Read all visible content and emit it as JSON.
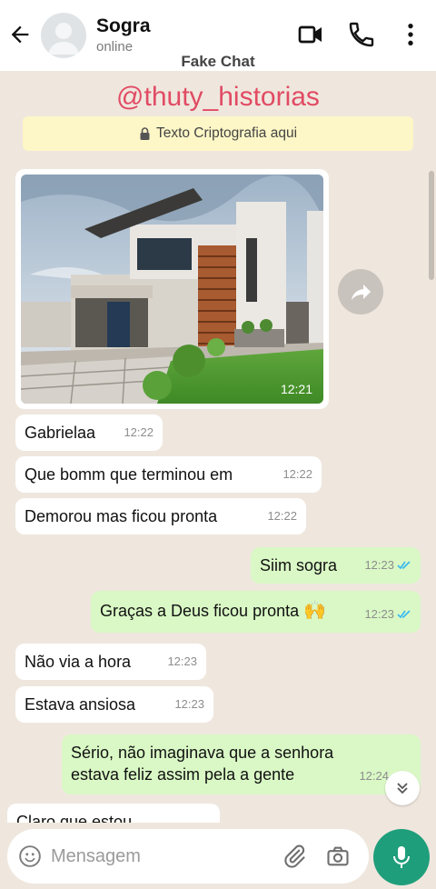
{
  "header": {
    "contact_name": "Sogra",
    "status": "online",
    "app_watermark": "Fake Chat"
  },
  "chat": {
    "user_watermark": "@thuty_historias",
    "encryption_notice": "Texto Criptografia aqui",
    "image_message": {
      "time": "12:21"
    },
    "messages": [
      {
        "dir": "in",
        "text": "Gabrielaa",
        "time": "12:22"
      },
      {
        "dir": "in",
        "text": "Que bomm que terminou em",
        "time": "12:22"
      },
      {
        "dir": "in",
        "text": "Demorou mas ficou pronta",
        "time": "12:22"
      },
      {
        "dir": "out",
        "text": "Siim sogra",
        "time": "12:23"
      },
      {
        "dir": "out",
        "text": "Graças a Deus ficou pronta",
        "emoji": "🙌",
        "time": "12:23"
      },
      {
        "dir": "in",
        "text": "Não via a hora",
        "time": "12:23"
      },
      {
        "dir": "in",
        "text": "Estava ansiosa",
        "time": "12:23"
      },
      {
        "dir": "out",
        "text": "Sério, não imaginava que a senhora estava feliz assim pela a gente",
        "line1": "Sério, não imaginava que a senhora",
        "line2": "estava feliz assim pela a gente",
        "time": "12:24"
      },
      {
        "dir": "in",
        "text": "Claro que estou",
        "time": ""
      }
    ]
  },
  "composer": {
    "placeholder": "Mensagem"
  },
  "colors": {
    "header_bg": "#ffffff",
    "chat_bg": "#efe7de",
    "incoming_bubble": "#ffffff",
    "outgoing_bubble": "#d9f8c5",
    "accent_green": "#1f9e7b",
    "watermark_pink": "#e14b63",
    "read_ticks": "#34b7f1"
  },
  "icons": {
    "back": "arrow-left-icon",
    "video": "video-call-icon",
    "call": "phone-icon",
    "menu": "more-vert-icon",
    "lock": "lock-icon",
    "forward": "forward-icon",
    "emoji": "emoji-icon",
    "attach": "paperclip-icon",
    "camera": "camera-icon",
    "mic": "mic-icon",
    "scroll": "chevron-double-down-icon"
  }
}
